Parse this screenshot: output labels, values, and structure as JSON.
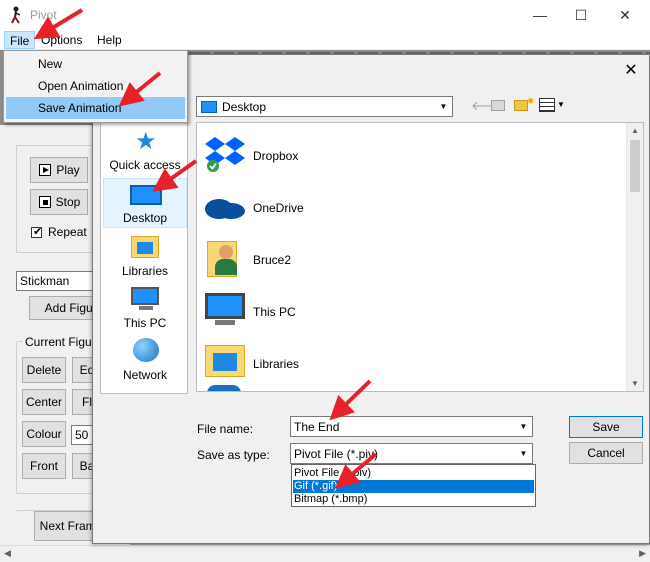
{
  "window": {
    "title": "Pivot",
    "controls": [
      "—",
      "☐",
      "✕"
    ]
  },
  "menubar": {
    "items": [
      "File",
      "Options",
      "Help"
    ]
  },
  "file_menu": {
    "items": [
      "New",
      "Open Animation",
      "Save Animation"
    ]
  },
  "left_panel": {
    "play_label": "Play",
    "stop_label": "Stop",
    "repeat_label": "Repeat",
    "figure_type": "Stickman",
    "add_figure_label": "Add Figure",
    "current_figure_label": "Current Figure",
    "delete_label": "Delete",
    "edit_label": "Ed",
    "center_label": "Center",
    "flip_label": "Fl",
    "colour_label": "Colour",
    "colour_value": "50",
    "front_label": "Front",
    "back_label": "Ba",
    "next_frame_label": "Next Frame"
  },
  "dialog": {
    "close_label": "✕",
    "save_in_value": "Desktop",
    "places": [
      "Quick access",
      "Desktop",
      "Libraries",
      "This PC",
      "Network"
    ],
    "files": [
      "Dropbox",
      "OneDrive",
      "Bruce2",
      "This PC",
      "Libraries"
    ],
    "file_name_label": "File name:",
    "file_name_value": "The End",
    "save_as_type_label": "Save as type:",
    "save_as_type_value": "Pivot File (*.piv)",
    "type_options": [
      "Pivot File (*.piv)",
      "Gif (*.gif)",
      "Bitmap (*.bmp)"
    ],
    "save_label": "Save",
    "cancel_label": "Cancel"
  },
  "colors": {
    "highlight": "#91c9f7",
    "selection": "#0078d7",
    "arrow": "#e8202a"
  }
}
